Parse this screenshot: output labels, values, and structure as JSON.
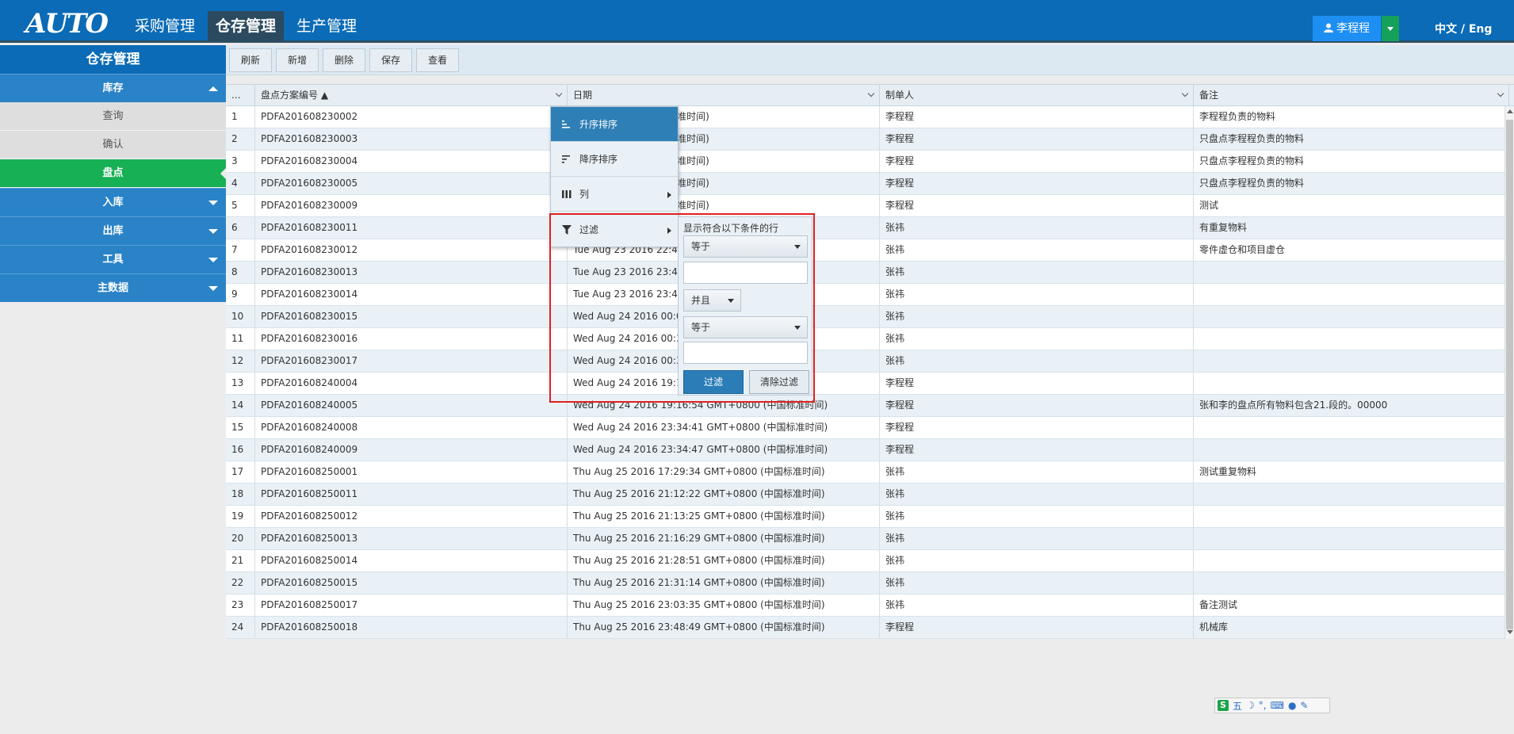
{
  "app": {
    "logo_text": "AUTO",
    "nav": [
      "采购管理",
      "仓存管理",
      "生产管理"
    ],
    "user": "李程程",
    "lang": "中文 / Eng"
  },
  "sidebar": {
    "title": "仓存管理",
    "groups": [
      {
        "label": "库存",
        "expanded": true,
        "items": [
          "查询",
          "确认",
          "盘点"
        ]
      },
      {
        "label": "入库",
        "expanded": false
      },
      {
        "label": "出库",
        "expanded": false
      },
      {
        "label": "工具",
        "expanded": false
      },
      {
        "label": "主数据",
        "expanded": false
      }
    ],
    "active_item": "盘点"
  },
  "toolbar": {
    "refresh": "刷新",
    "add": "新增",
    "delete": "删除",
    "save": "保存",
    "view": "查看"
  },
  "grid": {
    "columns": [
      "...",
      "盘点方案编号 ▲",
      "日期",
      "制单人",
      "备注"
    ],
    "rows": [
      [
        "1",
        "PDFA201608230002",
        "31 GMT+0800 (中国标准时间)",
        "李程程",
        "李程程负责的物料"
      ],
      [
        "2",
        "PDFA201608230003",
        "35 GMT+0800 (中国标准时间)",
        "李程程",
        "只盘点李程程负责的物料"
      ],
      [
        "3",
        "PDFA201608230004",
        "37 GMT+0800 (中国标准时间)",
        "李程程",
        "只盘点李程程负责的物料"
      ],
      [
        "4",
        "PDFA201608230005",
        "14 GMT+0800 (中国标准时间)",
        "李程程",
        "只盘点李程程负责的物料"
      ],
      [
        "5",
        "PDFA201608230009",
        "56 GMT+0800 (中国标准时间)",
        "李程程",
        "测试"
      ],
      [
        "6",
        "PDFA201608230011",
        "",
        "张祎",
        "有重复物料"
      ],
      [
        "7",
        "PDFA201608230012",
        "Tue Aug 23 2016 22:49",
        "张祎",
        "零件虚仓和项目虚仓"
      ],
      [
        "8",
        "PDFA201608230013",
        "Tue Aug 23 2016 23:41",
        "张祎",
        ""
      ],
      [
        "9",
        "PDFA201608230014",
        "Tue Aug 23 2016 23:42",
        "张祎",
        ""
      ],
      [
        "10",
        "PDFA201608230015",
        "Wed Aug 24 2016 00:02",
        "张祎",
        ""
      ],
      [
        "11",
        "PDFA201608230016",
        "Wed Aug 24 2016 00:36",
        "张祎",
        ""
      ],
      [
        "12",
        "PDFA201608230017",
        "Wed Aug 24 2016 00:36",
        "张祎",
        ""
      ],
      [
        "13",
        "PDFA201608240004",
        "Wed Aug 24 2016 19:16",
        "李程程",
        ""
      ],
      [
        "14",
        "PDFA201608240005",
        "Wed Aug 24 2016 19:16:54 GMT+0800 (中国标准时间)",
        "李程程",
        "张和李的盘点所有物料包含21.段的。00000"
      ],
      [
        "15",
        "PDFA201608240008",
        "Wed Aug 24 2016 23:34:41 GMT+0800 (中国标准时间)",
        "李程程",
        ""
      ],
      [
        "16",
        "PDFA201608240009",
        "Wed Aug 24 2016 23:34:47 GMT+0800 (中国标准时间)",
        "李程程",
        ""
      ],
      [
        "17",
        "PDFA201608250001",
        "Thu Aug 25 2016 17:29:34 GMT+0800 (中国标准时间)",
        "张祎",
        "测试重复物料"
      ],
      [
        "18",
        "PDFA201608250011",
        "Thu Aug 25 2016 21:12:22 GMT+0800 (中国标准时间)",
        "张祎",
        ""
      ],
      [
        "19",
        "PDFA201608250012",
        "Thu Aug 25 2016 21:13:25 GMT+0800 (中国标准时间)",
        "张祎",
        ""
      ],
      [
        "20",
        "PDFA201608250013",
        "Thu Aug 25 2016 21:16:29 GMT+0800 (中国标准时间)",
        "张祎",
        ""
      ],
      [
        "21",
        "PDFA201608250014",
        "Thu Aug 25 2016 21:28:51 GMT+0800 (中国标准时间)",
        "张祎",
        ""
      ],
      [
        "22",
        "PDFA201608250015",
        "Thu Aug 25 2016 21:31:14 GMT+0800 (中国标准时间)",
        "张祎",
        ""
      ],
      [
        "23",
        "PDFA201608250017",
        "Thu Aug 25 2016 23:03:35 GMT+0800 (中国标准时间)",
        "张祎",
        "备注测试"
      ],
      [
        "24",
        "PDFA201608250018",
        "Thu Aug 25 2016 23:48:49 GMT+0800 (中国标准时间)",
        "李程程",
        "机械库"
      ]
    ]
  },
  "column_menu": {
    "sort_asc": "升序排序",
    "sort_desc": "降序排序",
    "columns": "列",
    "filter": "过滤"
  },
  "filter_panel": {
    "label": "显示符合以下条件的行",
    "operator1": "等于",
    "logic": "并且",
    "operator2": "等于",
    "value1": "",
    "value2": "",
    "filter_btn": "过滤",
    "clear_btn": "清除过滤"
  },
  "ime": {
    "mode": "五"
  },
  "colors": {
    "header_blue": "#0b6bb6",
    "sidebar_group": "#2a83c7",
    "active_green": "#18b055",
    "highlight_red": "#e02020"
  }
}
